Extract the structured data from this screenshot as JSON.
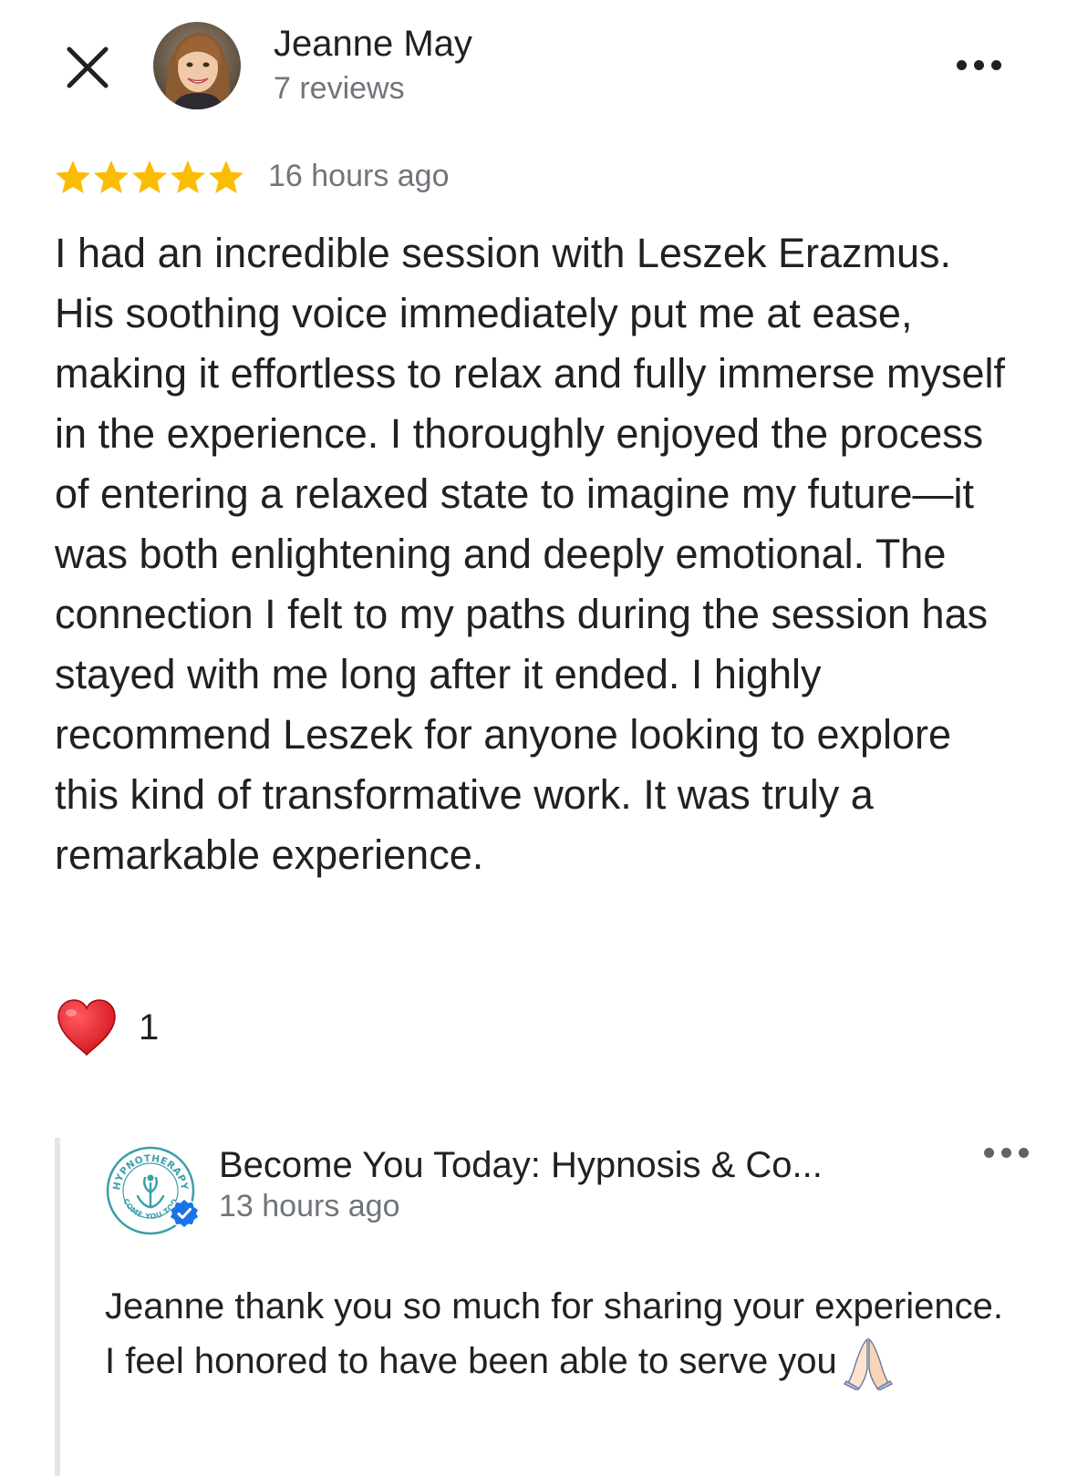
{
  "reviewer": {
    "name": "Jeanne May",
    "reviews_count": "7 reviews"
  },
  "review": {
    "rating": 5,
    "max_rating": 5,
    "time_ago": "16 hours ago",
    "text": "I had an incredible session with Leszek Erazmus. His soothing voice immediately put me at ease, making it effortless to relax and fully immerse myself in the experience. I thoroughly enjoyed the process of entering a relaxed state to imagine my future—it was both enlightening and deeply emotional. The connection I felt to my paths during the session has stayed with me long after it ended. I highly recommend Leszek for anyone looking to explore this kind of transformative work. It was truly a remarkable experience.",
    "reaction_count": "1"
  },
  "reply": {
    "business_name": "Become You Today: Hypnosis & Co...",
    "time_ago": "13 hours ago",
    "text": "Jeanne thank you so much for sharing your experience. I feel honored to have been able to serve you",
    "logo_text": "HYPNOTHERAPY AND COACHING LESZEK ERAZMUS BECOME YOU TODAY"
  },
  "colors": {
    "star": "#fbbc04",
    "heart": "#e0171f",
    "verified": "#1a73e8",
    "logo_teal": "#3aa0a8",
    "secondary_text": "#70757a"
  },
  "icons": {
    "close": "close-icon",
    "more": "more-horizontal-icon",
    "star": "star-icon",
    "heart": "heart-icon",
    "verified": "verified-badge-icon",
    "pray": "folded-hands-icon"
  }
}
